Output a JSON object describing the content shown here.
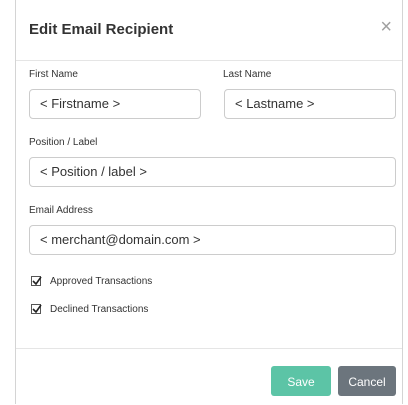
{
  "dialog": {
    "title": "Edit Email Recipient",
    "close_glyph": "×"
  },
  "fields": {
    "first_name": {
      "label": "First Name",
      "value": "< Firstname >"
    },
    "last_name": {
      "label": "Last Name",
      "value": "< Lastname >"
    },
    "position": {
      "label": "Position / Label",
      "value": "< Position / label >"
    },
    "email": {
      "label": "Email Address",
      "value": "< merchant@domain.com >"
    }
  },
  "checkboxes": [
    {
      "label": "Approved Transactions",
      "checked": true
    },
    {
      "label": "Declined Transactions",
      "checked": true
    }
  ],
  "buttons": {
    "save": "Save",
    "cancel": "Cancel"
  },
  "colors": {
    "save": "#5cc4a6",
    "cancel": "#6c757d"
  },
  "icons": {
    "close": "close-icon",
    "check": "check-icon"
  }
}
